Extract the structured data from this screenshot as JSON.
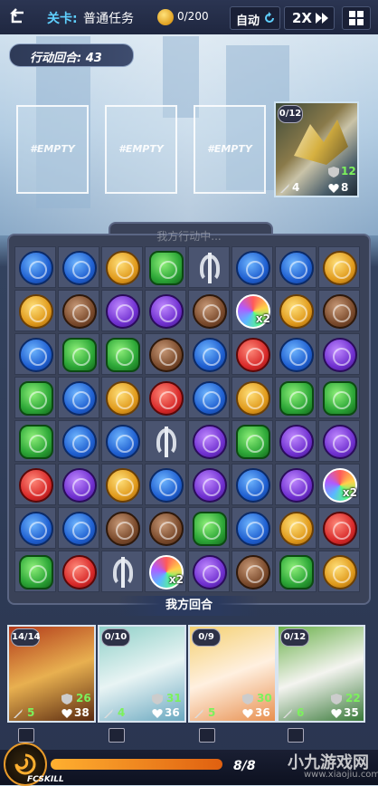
{
  "header": {
    "stage_label": "关卡:",
    "stage_name": "普通任务",
    "coins": "0/200",
    "auto_label": "自动",
    "speed_label": "2X"
  },
  "turn_counter": "行动回合: 43",
  "empty_slots": [
    "#EMPTY",
    "#EMPTY",
    "#EMPTY"
  ],
  "enemy": {
    "level": "0/12",
    "attack": "4",
    "shield": "12",
    "hp": "8"
  },
  "board": {
    "title": "我方行动中...",
    "rows": [
      [
        "blue",
        "blue",
        "yellow",
        "green",
        "silver",
        "blue",
        "blue",
        "yellow"
      ],
      [
        "yellow",
        "brown",
        "purple",
        "purple",
        "brown",
        "rainbow",
        "yellow",
        "brown"
      ],
      [
        "blue",
        "green",
        "green",
        "brown",
        "blue",
        "red",
        "blue",
        "purple"
      ],
      [
        "green",
        "blue",
        "yellow",
        "red",
        "blue",
        "yellow",
        "green",
        "green"
      ],
      [
        "green",
        "blue",
        "blue",
        "silver",
        "purple",
        "green",
        "purple",
        "purple"
      ],
      [
        "red",
        "purple",
        "yellow",
        "blue",
        "purple",
        "blue",
        "purple",
        "rainbow"
      ],
      [
        "blue",
        "blue",
        "brown",
        "brown",
        "green",
        "blue",
        "yellow",
        "red"
      ],
      [
        "green",
        "red",
        "silver",
        "rainbow",
        "purple",
        "brown",
        "green",
        "yellow"
      ]
    ],
    "multiplier": "x2"
  },
  "turn_banner": "我方回合",
  "heroes": [
    {
      "level": "14/14",
      "attack": "5",
      "shield": "26",
      "hp": "38",
      "colors": [
        "#b23a1a",
        "#e8b050",
        "#5a2a10"
      ]
    },
    {
      "level": "0/10",
      "attack": "4",
      "shield": "31",
      "hp": "36",
      "colors": [
        "#8fd0c8",
        "#e8f4f4",
        "#6aa8c0"
      ]
    },
    {
      "level": "0/9",
      "attack": "5",
      "shield": "30",
      "hp": "36",
      "colors": [
        "#f4d070",
        "#fff0e0",
        "#e89050"
      ]
    },
    {
      "level": "0/12",
      "attack": "6",
      "shield": "22",
      "hp": "35",
      "colors": [
        "#6ab04a",
        "#f4f4f0",
        "#3a7a3a"
      ]
    }
  ],
  "bottom": {
    "skill_label": "FCSKILL",
    "energy": "8/8",
    "energy_fraction": 1.0
  },
  "watermark": {
    "text": "小九游戏网",
    "url": "www.xiaojiu.com"
  }
}
